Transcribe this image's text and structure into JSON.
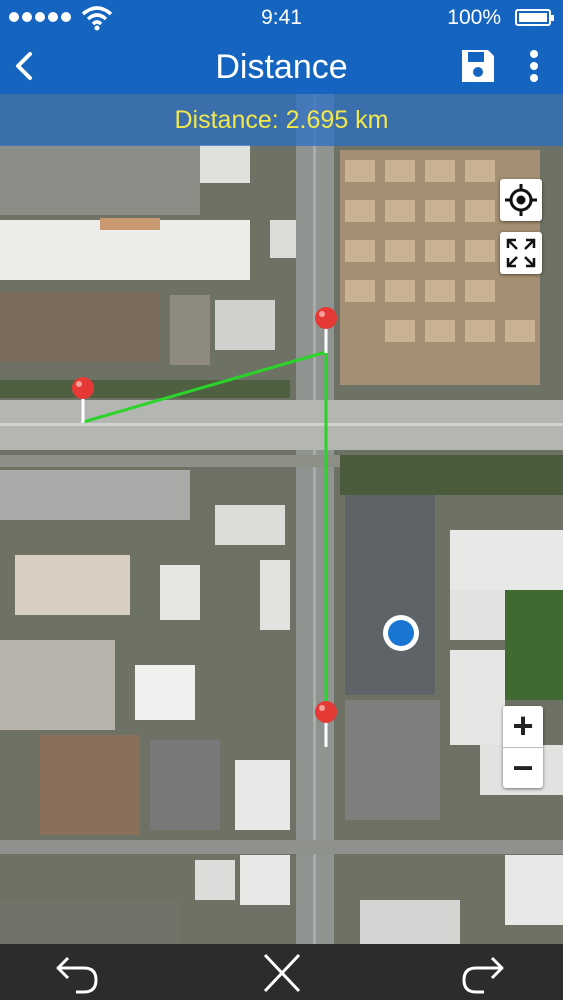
{
  "status_bar": {
    "time": "9:41",
    "battery": "100%"
  },
  "app_bar": {
    "title": "Distance"
  },
  "measurement": {
    "label": "Distance: 2.695 km"
  },
  "colors": {
    "primary": "#1565c0",
    "measure_text": "#f2e84a",
    "route_line": "#2bd42b",
    "pin": "#e53935",
    "location_dot": "#1976d2"
  },
  "controls": {
    "my_location": "crosshair-icon",
    "fit_bounds": "expand-icon",
    "zoom_in": "+",
    "zoom_out": "−",
    "undo": "undo-icon",
    "clear": "close-icon",
    "redo": "redo-icon"
  }
}
